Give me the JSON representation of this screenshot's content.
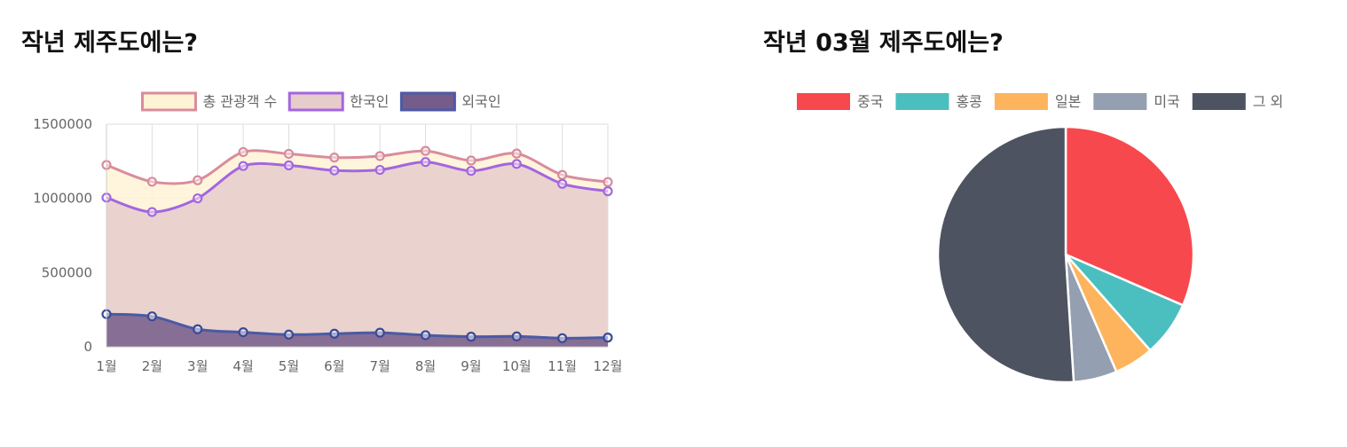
{
  "left_title": "작년 제주도에는?",
  "right_title": "작년 03월 제주도에는?",
  "chart_data": [
    {
      "type": "area",
      "title": "작년 제주도에는?",
      "categories": [
        "1월",
        "2월",
        "3월",
        "4월",
        "5월",
        "6월",
        "7월",
        "8월",
        "9월",
        "10월",
        "11월",
        "12월"
      ],
      "ylim": [
        0,
        1500000
      ],
      "yticks": [
        0,
        500000,
        1000000,
        1500000
      ],
      "grid": true,
      "legend_position": "top",
      "series": [
        {
          "name": "총 관광객 수",
          "values": [
            1225000,
            1112000,
            1122000,
            1312000,
            1300000,
            1275000,
            1285000,
            1320000,
            1255000,
            1302000,
            1158000,
            1110000
          ],
          "stroke": "#d98c9c",
          "fill": "#fff3d6",
          "point": "#d98c9c"
        },
        {
          "name": "한국인",
          "values": [
            1005000,
            908000,
            1000000,
            1218000,
            1222000,
            1188000,
            1192000,
            1245000,
            1185000,
            1232000,
            1098000,
            1048000
          ],
          "stroke": "#a366e0",
          "fill": "#e6cccb",
          "point": "#a366e0"
        },
        {
          "name": "외국인",
          "values": [
            220000,
            205000,
            118000,
            98000,
            82000,
            88000,
            95000,
            78000,
            68000,
            70000,
            58000,
            62000
          ],
          "stroke": "#4a5aa6",
          "fill": "#765c8a",
          "point": "#3a4a98"
        }
      ]
    },
    {
      "type": "pie",
      "title": "작년 03월 제주도에는?",
      "legend_position": "top",
      "labels": [
        "중국",
        "홍콩",
        "일본",
        "미국",
        "그 외"
      ],
      "values": [
        31.5,
        7.0,
        5.0,
        5.5,
        51.0
      ],
      "colors": [
        "#f7484e",
        "#4bbfbf",
        "#fdb45c",
        "#949fb1",
        "#4d5360"
      ]
    }
  ]
}
